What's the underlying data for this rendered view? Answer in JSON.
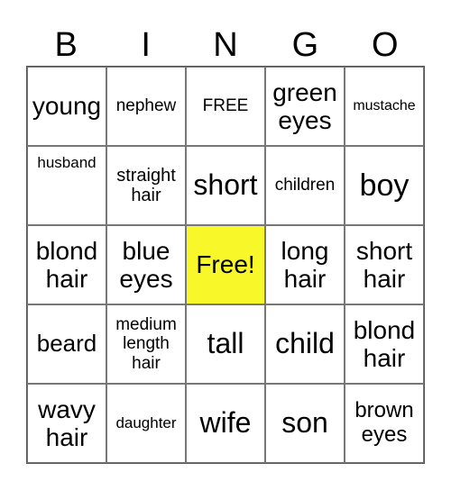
{
  "header": [
    "B",
    "I",
    "N",
    "G",
    "O"
  ],
  "free_color": "#f7f72a",
  "cells": [
    {
      "text": "young",
      "size": 28
    },
    {
      "text": "nephew",
      "size": 19
    },
    {
      "text": "FREE",
      "size": 19
    },
    {
      "text": "green eyes",
      "size": 28
    },
    {
      "text": "mustache",
      "size": 16
    },
    {
      "text": "husband",
      "size": 17,
      "align": "top"
    },
    {
      "text": "straight hair",
      "size": 20
    },
    {
      "text": "short",
      "size": 32
    },
    {
      "text": "children",
      "size": 19
    },
    {
      "text": "boy",
      "size": 34
    },
    {
      "text": "blond hair",
      "size": 28
    },
    {
      "text": "blue eyes",
      "size": 28
    },
    {
      "text": "Free!",
      "size": 28,
      "free": true
    },
    {
      "text": "long hair",
      "size": 28
    },
    {
      "text": "short hair",
      "size": 28
    },
    {
      "text": "beard",
      "size": 26
    },
    {
      "text": "medium length hair",
      "size": 19
    },
    {
      "text": "tall",
      "size": 32
    },
    {
      "text": "child",
      "size": 32
    },
    {
      "text": "blond hair",
      "size": 28
    },
    {
      "text": "wavy hair",
      "size": 28
    },
    {
      "text": "daughter",
      "size": 17
    },
    {
      "text": "wife",
      "size": 32
    },
    {
      "text": "son",
      "size": 32
    },
    {
      "text": "brown eyes",
      "size": 24
    }
  ]
}
